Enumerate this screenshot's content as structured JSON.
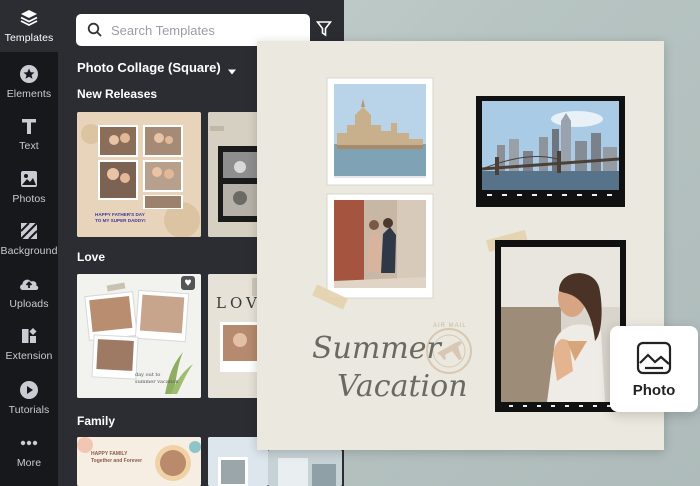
{
  "rail": {
    "items": [
      {
        "label": "Templates",
        "icon": "layers-icon",
        "active": true
      },
      {
        "label": "Elements",
        "icon": "star-icon"
      },
      {
        "label": "Text",
        "icon": "text-icon"
      },
      {
        "label": "Photos",
        "icon": "image-icon"
      },
      {
        "label": "Background",
        "icon": "background-icon"
      },
      {
        "label": "Uploads",
        "icon": "upload-cloud-icon"
      },
      {
        "label": "Extension",
        "icon": "extension-icon"
      },
      {
        "label": "Tutorials",
        "icon": "play-icon"
      },
      {
        "label": "More",
        "icon": "more-dots-icon"
      }
    ]
  },
  "panel": {
    "search_placeholder": "Search Templates",
    "category": "Photo Collage (Square)",
    "sections": [
      {
        "title": "New Releases"
      },
      {
        "title": "Love"
      },
      {
        "title": "Family"
      }
    ],
    "thumb_texts": {
      "fathers_day": "HAPPY FATHER'S DAY\nTO MY SUPER DADDY!",
      "love_word": "LOVE",
      "summer_small": "day out to\nsummer vacation",
      "happy_family": "HAPPY FAMILY\nTogether and Forever"
    }
  },
  "canvas": {
    "title_line1": "Summer",
    "title_line2": "Vacation",
    "stamp_text": "AIR MAIL"
  },
  "photo_card": {
    "label": "Photo",
    "icon": "photo-icon"
  },
  "colors": {
    "rail_bg": "#17181c",
    "panel_bg": "#2b2d33",
    "canvas_bg": "#ebe9df"
  }
}
